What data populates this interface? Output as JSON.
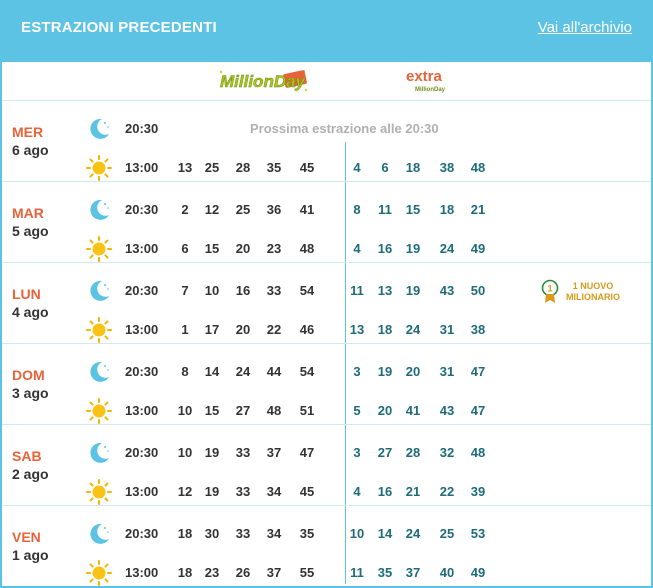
{
  "header": {
    "title": "ESTRAZIONI PRECEDENTI",
    "archive_link": "Vai all'archivio"
  },
  "logos": {
    "million_day": "MillionDay",
    "extra_top": "extra",
    "extra_bottom": "MillionDay"
  },
  "colors": {
    "header_bg": "#5cc3e4",
    "day_name": "#e8633a",
    "extra_numbers": "#1e6b7a",
    "pending_text": "#b0b0b0",
    "badge": "#d99a1b"
  },
  "icons": {
    "evening": "moon-icon",
    "afternoon": "sun-icon",
    "badge": "medal-icon"
  },
  "days": [
    {
      "name": "MER",
      "date": "6 ago",
      "draws": [
        {
          "time": "20:30",
          "icon": "moon-icon",
          "pending_text": "Prossima estrazione alle 20:30",
          "numbers": [],
          "extra": []
        },
        {
          "time": "13:00",
          "icon": "sun-icon",
          "numbers": [
            "13",
            "25",
            "28",
            "35",
            "45"
          ],
          "extra": [
            "4",
            "6",
            "18",
            "38",
            "48"
          ]
        }
      ]
    },
    {
      "name": "MAR",
      "date": "5 ago",
      "draws": [
        {
          "time": "20:30",
          "icon": "moon-icon",
          "numbers": [
            "2",
            "12",
            "25",
            "36",
            "41"
          ],
          "extra": [
            "8",
            "11",
            "15",
            "18",
            "21"
          ]
        },
        {
          "time": "13:00",
          "icon": "sun-icon",
          "numbers": [
            "6",
            "15",
            "20",
            "23",
            "48"
          ],
          "extra": [
            "4",
            "16",
            "19",
            "24",
            "49"
          ]
        }
      ]
    },
    {
      "name": "LUN",
      "date": "4 ago",
      "draws": [
        {
          "time": "20:30",
          "icon": "moon-icon",
          "numbers": [
            "7",
            "10",
            "16",
            "33",
            "54"
          ],
          "extra": [
            "11",
            "13",
            "19",
            "43",
            "50"
          ],
          "badge": {
            "count": "1",
            "line1": "1 NUOVO",
            "line2": "MILIONARIO"
          }
        },
        {
          "time": "13:00",
          "icon": "sun-icon",
          "numbers": [
            "1",
            "17",
            "20",
            "22",
            "46"
          ],
          "extra": [
            "13",
            "18",
            "24",
            "31",
            "38"
          ]
        }
      ]
    },
    {
      "name": "DOM",
      "date": "3 ago",
      "draws": [
        {
          "time": "20:30",
          "icon": "moon-icon",
          "numbers": [
            "8",
            "14",
            "24",
            "44",
            "54"
          ],
          "extra": [
            "3",
            "19",
            "20",
            "31",
            "47"
          ]
        },
        {
          "time": "13:00",
          "icon": "sun-icon",
          "numbers": [
            "10",
            "15",
            "27",
            "48",
            "51"
          ],
          "extra": [
            "5",
            "20",
            "41",
            "43",
            "47"
          ]
        }
      ]
    },
    {
      "name": "SAB",
      "date": "2 ago",
      "draws": [
        {
          "time": "20:30",
          "icon": "moon-icon",
          "numbers": [
            "10",
            "19",
            "33",
            "37",
            "47"
          ],
          "extra": [
            "3",
            "27",
            "28",
            "32",
            "48"
          ]
        },
        {
          "time": "13:00",
          "icon": "sun-icon",
          "numbers": [
            "12",
            "19",
            "33",
            "34",
            "45"
          ],
          "extra": [
            "4",
            "16",
            "21",
            "22",
            "39"
          ]
        }
      ]
    },
    {
      "name": "VEN",
      "date": "1 ago",
      "draws": [
        {
          "time": "20:30",
          "icon": "moon-icon",
          "numbers": [
            "18",
            "30",
            "33",
            "34",
            "35"
          ],
          "extra": [
            "10",
            "14",
            "24",
            "25",
            "53"
          ]
        },
        {
          "time": "13:00",
          "icon": "sun-icon",
          "numbers": [
            "18",
            "23",
            "26",
            "37",
            "55"
          ],
          "extra": [
            "11",
            "35",
            "37",
            "40",
            "49"
          ]
        }
      ]
    }
  ]
}
